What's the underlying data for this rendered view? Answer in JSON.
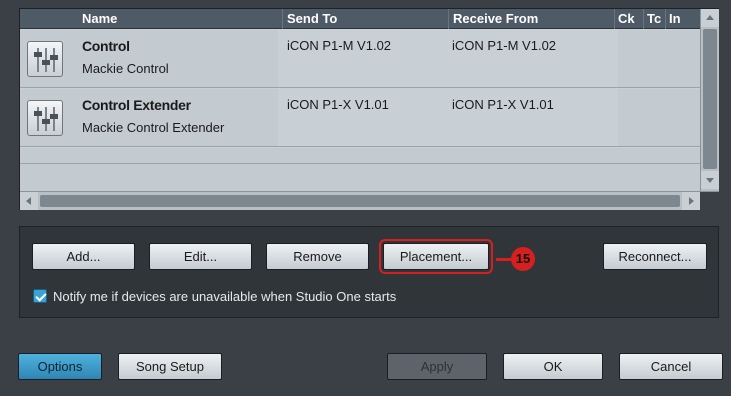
{
  "table": {
    "headers": {
      "name": "Name",
      "send_to": "Send To",
      "receive_from": "Receive From",
      "ck": "Ck",
      "tc": "Tc",
      "in": "In"
    },
    "rows": [
      {
        "name": "Control",
        "description": "Mackie Control",
        "send_to": "iCON P1-M V1.02",
        "receive_from": "iCON P1-M V1.02",
        "icon": "mixer-fader-icon"
      },
      {
        "name": "Control Extender",
        "description": "Mackie Control Extender",
        "send_to": "iCON P1-X V1.01",
        "receive_from": "iCON P1-X V1.01",
        "icon": "mixer-fader-icon"
      }
    ]
  },
  "buttons": {
    "add": "Add...",
    "edit": "Edit...",
    "remove": "Remove",
    "placement": "Placement...",
    "reconnect": "Reconnect..."
  },
  "callout": {
    "number": "15",
    "color": "#d61f1f"
  },
  "notify": {
    "checked": true,
    "label": "Notify me if devices are unavailable when Studio One starts"
  },
  "footer": {
    "options": "Options",
    "song_setup": "Song Setup",
    "apply": "Apply",
    "ok": "OK",
    "cancel": "Cancel"
  },
  "colors": {
    "accent": "#3aa2d4",
    "highlight": "#d61f1f"
  }
}
